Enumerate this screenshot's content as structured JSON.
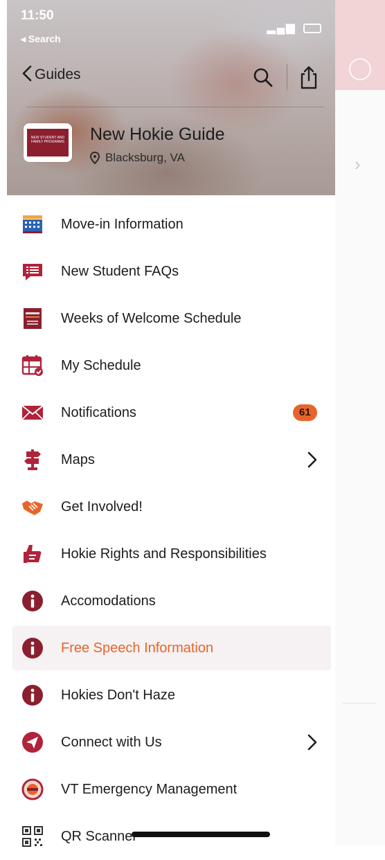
{
  "status_bar": {
    "time": "11:50",
    "back_app": "◂ Search"
  },
  "header": {
    "back_label": "Guides",
    "guide_title": "New Hokie Guide",
    "guide_location": "Blacksburg, VA",
    "logo_text": "NEW STUDENT AND FAMILY PROGRAMS"
  },
  "menu": [
    {
      "label": "Move-in Information",
      "icon": "building-icon"
    },
    {
      "label": "New Student FAQs",
      "icon": "faq-chat-icon"
    },
    {
      "label": "Weeks of Welcome Schedule",
      "icon": "on-track-book-icon"
    },
    {
      "label": "My Schedule",
      "icon": "calendar-check-icon"
    },
    {
      "label": "Notifications",
      "icon": "envelope-icon",
      "badge": "61"
    },
    {
      "label": "Maps",
      "icon": "signpost-icon",
      "has_chevron": true
    },
    {
      "label": "Get Involved!",
      "icon": "handshake-icon"
    },
    {
      "label": "Hokie Rights and Responsibilities",
      "icon": "thumbs-up-icon"
    },
    {
      "label": "Accomodations",
      "icon": "info-icon"
    },
    {
      "label": "Free Speech Information",
      "icon": "info-icon",
      "selected": true
    },
    {
      "label": "Hokies Don't Haze",
      "icon": "info-icon"
    },
    {
      "label": "Connect with Us",
      "icon": "send-arrow-icon",
      "has_chevron": true
    },
    {
      "label": "VT Emergency Management",
      "icon": "emergency-seal-icon"
    },
    {
      "label": "QR Scanner",
      "icon": "qr-code-icon"
    }
  ],
  "colors": {
    "maroon": "#8b1f2e",
    "accent_orange": "#e8642b",
    "selected_bg": "#f6f1f2"
  }
}
